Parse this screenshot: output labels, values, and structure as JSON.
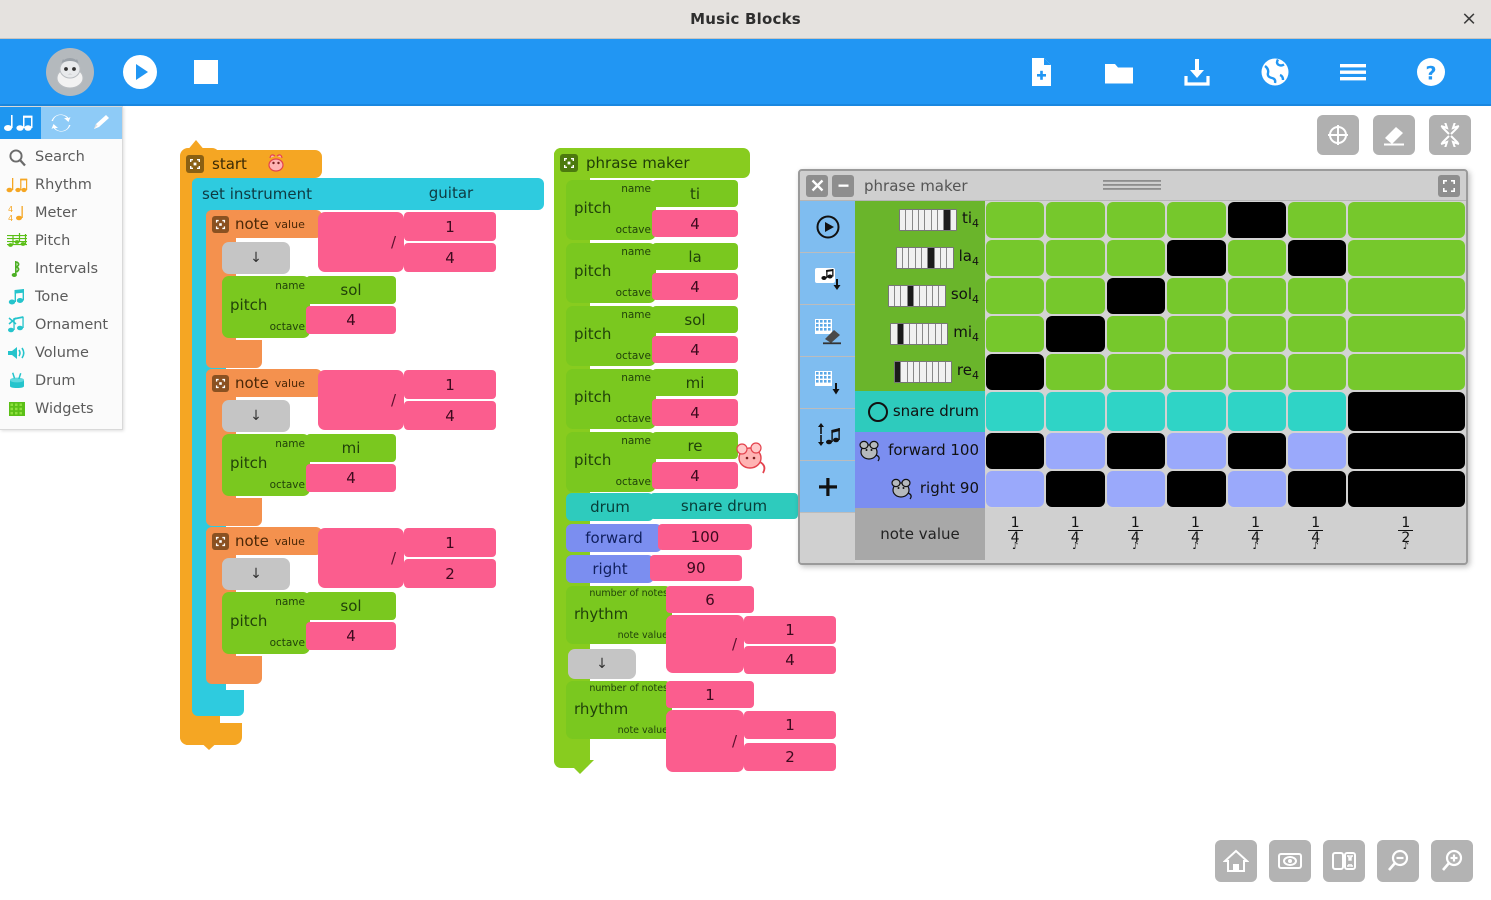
{
  "window": {
    "title": "Music Blocks",
    "close_label": "×"
  },
  "toolbar": {
    "left": [
      {
        "name": "mouse-logo",
        "label": "Mouse logo"
      },
      {
        "name": "play-button",
        "label": "Play"
      },
      {
        "name": "stop-button",
        "label": "Stop"
      }
    ],
    "right": [
      {
        "name": "new-project-icon",
        "label": "New project"
      },
      {
        "name": "open-folder-icon",
        "label": "Open"
      },
      {
        "name": "save-download-icon",
        "label": "Save"
      },
      {
        "name": "planet-globe-icon",
        "label": "Planet"
      },
      {
        "name": "hamburger-menu-icon",
        "label": "Menu"
      },
      {
        "name": "help-icon",
        "label": "Help"
      }
    ]
  },
  "palette": {
    "tabs": [
      {
        "name": "notes-tab",
        "label": "♪♫",
        "active": true
      },
      {
        "name": "refresh-tab",
        "label": "refresh"
      },
      {
        "name": "pencil-tab",
        "label": "pencil"
      }
    ],
    "items": [
      {
        "icon": "search-icon",
        "label": "Search"
      },
      {
        "icon": "rhythm-icon",
        "label": "Rhythm"
      },
      {
        "icon": "meter-icon",
        "label": "Meter"
      },
      {
        "icon": "pitch-icon",
        "label": "Pitch"
      },
      {
        "icon": "intervals-icon",
        "label": "Intervals"
      },
      {
        "icon": "tone-icon",
        "label": "Tone"
      },
      {
        "icon": "ornament-icon",
        "label": "Ornament"
      },
      {
        "icon": "volume-icon",
        "label": "Volume"
      },
      {
        "icon": "drum-icon",
        "label": "Drum"
      },
      {
        "icon": "widgets-icon",
        "label": "Widgets"
      }
    ]
  },
  "canvas_tools": [
    {
      "name": "grid-icon",
      "label": "Grid"
    },
    {
      "name": "eraser-icon",
      "label": "Clear"
    },
    {
      "name": "collapse-icon",
      "label": "Collapse"
    }
  ],
  "bottom_tools": [
    {
      "name": "home-icon",
      "label": "Home"
    },
    {
      "name": "show-blocks-icon",
      "label": "Show/Hide blocks"
    },
    {
      "name": "expand-blocks-icon",
      "label": "Expand blocks"
    },
    {
      "name": "zoom-out-icon",
      "label": "Zoom out"
    },
    {
      "name": "zoom-in-icon",
      "label": "Zoom in"
    }
  ],
  "blocks": {
    "start_stack": {
      "start_label": "start",
      "set_instrument_label": "set instrument",
      "instrument_value": "guitar",
      "notes": [
        {
          "note_label": "note",
          "value_label": "value",
          "numerator": "1",
          "denominator": "4",
          "divider": "/",
          "arrow": "↓",
          "pitch_label": "pitch",
          "name_label": "name",
          "octave_label": "octave",
          "solfege": "sol",
          "octave": "4"
        },
        {
          "note_label": "note",
          "value_label": "value",
          "numerator": "1",
          "denominator": "4",
          "divider": "/",
          "arrow": "↓",
          "pitch_label": "pitch",
          "name_label": "name",
          "octave_label": "octave",
          "solfege": "mi",
          "octave": "4"
        },
        {
          "note_label": "note",
          "value_label": "value",
          "numerator": "1",
          "denominator": "2",
          "divider": "/",
          "arrow": "↓",
          "pitch_label": "pitch",
          "name_label": "name",
          "octave_label": "octave",
          "solfege": "sol",
          "octave": "4"
        }
      ]
    },
    "phrase_stack": {
      "header_label": "phrase maker",
      "pitches": [
        {
          "name_label": "name",
          "pitch_label": "pitch",
          "octave_label": "octave",
          "solfege": "ti",
          "octave": "4"
        },
        {
          "name_label": "name",
          "pitch_label": "pitch",
          "octave_label": "octave",
          "solfege": "la",
          "octave": "4"
        },
        {
          "name_label": "name",
          "pitch_label": "pitch",
          "octave_label": "octave",
          "solfege": "sol",
          "octave": "4"
        },
        {
          "name_label": "name",
          "pitch_label": "pitch",
          "octave_label": "octave",
          "solfege": "mi",
          "octave": "4"
        },
        {
          "name_label": "name",
          "pitch_label": "pitch",
          "octave_label": "octave",
          "solfege": "re",
          "octave": "4"
        }
      ],
      "drum_label": "drum",
      "drum_value": "snare drum",
      "forward_label": "forward",
      "forward_value": "100",
      "right_label": "right",
      "right_value": "90",
      "rhythms": [
        {
          "count_label": "number of notes",
          "rhythm_label": "rhythm",
          "notevalue_label": "note value",
          "count": "6",
          "numerator": "1",
          "denominator": "4",
          "divider": "/",
          "arrow": "↓"
        },
        {
          "count_label": "number of notes",
          "rhythm_label": "rhythm",
          "notevalue_label": "note value",
          "count": "1",
          "numerator": "1",
          "denominator": "2",
          "divider": "/"
        }
      ]
    }
  },
  "phrase_maker_widget": {
    "title": "phrase maker",
    "close_label": "×",
    "minimize_label": "–",
    "maximize_name": "maximize-icon",
    "sidebar": [
      {
        "name": "play-all-icon",
        "label": "Play all"
      },
      {
        "name": "save-phrase-icon",
        "label": "Save phrase"
      },
      {
        "name": "clear-grid-icon",
        "label": "Clear grid"
      },
      {
        "name": "export-grid-icon",
        "label": "Export grid"
      },
      {
        "name": "sort-notes-icon",
        "label": "Sort notes"
      },
      {
        "name": "add-note-icon",
        "label": "+"
      }
    ],
    "footer_label": "note value",
    "chart_data": {
      "type": "heatmap",
      "title": "phrase maker",
      "xlabel": "note value",
      "columns": [
        {
          "index": 1,
          "note_value": "1/4",
          "numerator": "1",
          "denominator": "4",
          "width": 1
        },
        {
          "index": 2,
          "note_value": "1/4",
          "numerator": "1",
          "denominator": "4",
          "width": 1
        },
        {
          "index": 3,
          "note_value": "1/4",
          "numerator": "1",
          "denominator": "4",
          "width": 1
        },
        {
          "index": 4,
          "note_value": "1/4",
          "numerator": "1",
          "denominator": "4",
          "width": 1
        },
        {
          "index": 5,
          "note_value": "1/4",
          "numerator": "1",
          "denominator": "4",
          "width": 1
        },
        {
          "index": 6,
          "note_value": "1/4",
          "numerator": "1",
          "denominator": "4",
          "width": 1
        },
        {
          "index": 7,
          "note_value": "1/2",
          "numerator": "1",
          "denominator": "2",
          "width": 2
        }
      ],
      "rows": [
        {
          "label": "ti",
          "octave": "4",
          "kind": "note",
          "color": "#76c82c",
          "label_bg": "#6ab52b",
          "piano_key": 8,
          "cells": [
            0,
            0,
            0,
            0,
            1,
            0,
            0
          ]
        },
        {
          "label": "la",
          "octave": "4",
          "kind": "note",
          "color": "#76c82c",
          "label_bg": "#6ab52b",
          "piano_key": 6,
          "cells": [
            0,
            0,
            0,
            1,
            0,
            1,
            0
          ]
        },
        {
          "label": "sol",
          "octave": "4",
          "kind": "note",
          "color": "#76c82c",
          "label_bg": "#6ab52b",
          "piano_key": 4,
          "cells": [
            0,
            0,
            1,
            0,
            0,
            0,
            0
          ]
        },
        {
          "label": "mi",
          "octave": "4",
          "kind": "note",
          "color": "#76c82c",
          "label_bg": "#6ab52b",
          "piano_key": 2,
          "cells": [
            0,
            1,
            0,
            0,
            0,
            0,
            0
          ]
        },
        {
          "label": "re",
          "octave": "4",
          "kind": "note",
          "color": "#76c82c",
          "label_bg": "#6ab52b",
          "piano_key": 1,
          "cells": [
            1,
            0,
            0,
            0,
            0,
            0,
            0
          ]
        },
        {
          "label": "snare drum",
          "octave": "",
          "kind": "drum",
          "color": "#2fd4c6",
          "label_bg": "#2ecbbd",
          "cells": [
            0,
            0,
            0,
            0,
            0,
            0,
            1
          ]
        },
        {
          "label": "forward 100",
          "octave": "",
          "kind": "mouse",
          "color": "#9aa9fb",
          "label_bg": "#7b8ef0",
          "cells": [
            1,
            0,
            1,
            0,
            1,
            0,
            1
          ]
        },
        {
          "label": "right 90",
          "octave": "",
          "kind": "mouse",
          "color": "#9aa9fb",
          "label_bg": "#7b8ef0",
          "cells": [
            0,
            1,
            0,
            1,
            0,
            1,
            1
          ]
        }
      ]
    }
  },
  "colors": {
    "toolbar_blue": "#2196f3",
    "start_orange": "#f5a623",
    "instrument_cyan": "#2ecbdf",
    "note_orange": "#f4914e",
    "pitch_green": "#7ac81f",
    "phrase_green": "#88cc1f",
    "value_pink": "#fb5d8e",
    "mouse_blue": "#7b8ef0",
    "drum_teal": "#2ecbbd",
    "cell_on": "#000000"
  }
}
